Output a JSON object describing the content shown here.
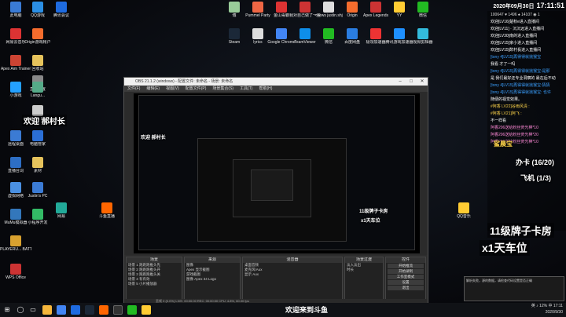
{
  "stream_clock": {
    "date": "2020年09月30日",
    "time": "17:11:51"
  },
  "desktop_icons": [
    {
      "name": "recycle-bin",
      "label": "此电脑",
      "color": "#3a7bd5"
    },
    {
      "name": "qq",
      "label": "QQ游戏",
      "color": "#2b8fe5"
    },
    {
      "name": "netease",
      "label": "腾讯会议",
      "color": "#1e6be0"
    },
    {
      "name": "netease-music",
      "label": "网易云音乐",
      "color": "#d33"
    },
    {
      "name": "origin-blue",
      "label": "Origin游戏帐户",
      "color": "#f56c2d"
    },
    {
      "name": "apex",
      "label": "Apex Aim Trainer",
      "color": "#c43"
    },
    {
      "name": "folder1",
      "label": "回收站",
      "color": "#e6c35c"
    },
    {
      "name": "recording",
      "label": "直播配置",
      "color": "#888"
    },
    {
      "name": "tencent",
      "label": "小游戏",
      "color": "#24a0ff"
    },
    {
      "name": "lang",
      "label": "Langu...",
      "color": "#5a8"
    },
    {
      "name": "which",
      "label": "Which R...",
      "color": "#ccc"
    },
    {
      "name": "rdp",
      "label": "远程桌面",
      "color": "#3b7bd4"
    },
    {
      "name": "cleaner",
      "label": "电脑管家",
      "color": "#2b6fd6"
    },
    {
      "name": "doc",
      "label": "直播台词",
      "color": "#2d6ec4"
    },
    {
      "name": "folder2",
      "label": "素材",
      "color": "#e6c35c"
    },
    {
      "name": "network",
      "label": "虚拟网络",
      "color": "#4a90e2"
    },
    {
      "name": "justin-pc",
      "label": "Justin's PC",
      "color": "#3b7bd4"
    },
    {
      "name": "wechat",
      "label": "网易",
      "color": "#2a9"
    },
    {
      "name": "douyu",
      "label": "斗鱼直播",
      "color": "#f60"
    },
    {
      "name": "mumu",
      "label": "MuMu模拟器",
      "color": "#37b"
    },
    {
      "name": "miniprog",
      "label": "小程序开发",
      "color": "#3b6"
    },
    {
      "name": "playerunknown",
      "label": "PLAYERU... BATTLEGR...",
      "color": "#d8a12f"
    },
    {
      "name": "wps",
      "label": "WPS Office",
      "color": "#c33"
    },
    {
      "name": "qqmusic",
      "label": "QQ音乐",
      "color": "#fc3"
    }
  ],
  "top_icons": [
    {
      "name": "notepad",
      "label": "傅",
      "color": "#9c9"
    },
    {
      "name": "pummel-party",
      "label": "Pummel Party",
      "color": "#e64"
    },
    {
      "name": "360",
      "label": "金山毒霸",
      "color": "#d33"
    },
    {
      "name": "chinese-app",
      "label": "我对自己做了一些",
      "color": "#c33"
    },
    {
      "name": "newsclaws",
      "label": "<news justin.shj",
      "color": "#ddd"
    },
    {
      "name": "origin",
      "label": "Origin",
      "color": "#f56c2d"
    },
    {
      "name": "apex-legends",
      "label": "Apex Legends",
      "color": "#c33"
    },
    {
      "name": "yy",
      "label": "YY",
      "color": "#fc3"
    },
    {
      "name": "wechat2",
      "label": "微信",
      "color": "#2b2"
    },
    {
      "name": "steam",
      "label": "Steam",
      "color": "#1b2838"
    },
    {
      "name": "lyrics",
      "label": "lyrics",
      "color": "#ddd"
    },
    {
      "name": "chrome",
      "label": "Google Chrome",
      "color": "#4285f4"
    },
    {
      "name": "teamviewer",
      "label": "TeamViewer",
      "color": "#0e8ee9"
    },
    {
      "name": "telegram",
      "label": "微信",
      "color": "#2b2"
    },
    {
      "name": "baidu",
      "label": "百度网盘",
      "color": "#2a7de1"
    },
    {
      "name": "gesture",
      "label": "极领加速器",
      "color": "#e33"
    },
    {
      "name": "tencent-video",
      "label": "腾讯游戏加速器",
      "color": "#1e90ff"
    },
    {
      "name": "video-edit",
      "label": "视频剪辑器",
      "color": "#3bd"
    }
  ],
  "chat": {
    "stats": "100647 ♥ 1496 ♠ 14107 ◉ 1",
    "lines": [
      {
        "text": "欢迎[LV16]楚秋e进入直播间",
        "style": "plain"
      },
      {
        "text": "欢迎[LV11] · 沉沉远进入直播间",
        "style": "plain"
      },
      {
        "text": "欢迎[LV30]南的进入直播间",
        "style": "plain"
      },
      {
        "text": "欢迎[LV15]家小进入直播间",
        "style": "plain"
      },
      {
        "text": "欢迎[LV15]酢村長进入直播间",
        "style": "plain"
      },
      {
        "text": "[tony 4]LV15]再得得就抛猴宝",
        "style": "blue"
      },
      {
        "text": "我看 才了一吗",
        "style": "plain"
      },
      {
        "text": "[tony 4]LV15]再得得就抛猴宝:是那",
        "style": "blue"
      },
      {
        "text": "是 我们最好还专业洞察的 最在后不动",
        "style": "plain"
      },
      {
        "text": "[tony 4]LV15]再得得就抛猴宝:猜猜",
        "style": "blue"
      },
      {
        "text": "[tony 4]LV15]再得得就抛猴宝: 也许",
        "style": "blue"
      },
      {
        "text": "随便的视觉效果。",
        "style": "plain"
      },
      {
        "text": "#阿香 LV22]谷雨风清 :",
        "style": "yellow"
      },
      {
        "text": "#阿香 LV21]阿飞 :",
        "style": "yellow"
      },
      {
        "text": "不一样看",
        "style": "plain"
      },
      {
        "text": "阿香206送给粉丝荧光棒*10",
        "style": "pink"
      },
      {
        "text": "阿香206送给粉丝荧光棒*20",
        "style": "pink"
      },
      {
        "text": "阿香206送给粉丝荧光棒*10",
        "style": "pink"
      }
    ]
  },
  "overlay": {
    "brand_badge": "鲨晨宝",
    "task_labels": [
      "办卡 (16/20)",
      "飞机 (1/3)"
    ],
    "banner_main": "11级牌子卡房",
    "banner_sub": "x1天车位",
    "welcome_left": "欢迎 郝村长",
    "bottom_caption": "欢迎来到斗鱼"
  },
  "obs": {
    "title": "OBS 21.1.2 (windows) - 配置文件: 未命名 - 场景: 未命名",
    "menu": [
      "文件(F)",
      "编辑(E)",
      "视图(V)",
      "配置文件(P)",
      "场景集合(S)",
      "工具(T)",
      "帮助(H)"
    ],
    "docks": {
      "scenes": {
        "title": "场景",
        "items": [
          "场景 1 跑跑跑推头先",
          "场景 2 跑跑跑推头开",
          "场景 3 跑跑跑推头关",
          "场景 4 有有效",
          "场景 5 小片播放器"
        ]
      },
      "sources": {
        "title": "来源",
        "items": [
          "图像",
          "Apex 显示截图",
          "游戏截图",
          "图像 Apex 34 Logo"
        ]
      },
      "mixer": {
        "title": "混音器",
        "items": [
          "桌面音频",
          "麦克风/Aux",
          "显示 Aux"
        ]
      },
      "transitions": {
        "title": "场景过渡",
        "items": [
          "淡入淡出",
          "时长"
        ]
      },
      "controls": {
        "title": "控件",
        "buttons": [
          "开始推流",
          "开始录制",
          "工作室模式",
          "设置",
          "退出"
        ]
      }
    },
    "status": "丢帧 0 (0.0%)   LIVE: 00:00:00   REC: 00:00:00   CPU: 4.8%, 60.00 fps"
  },
  "warn_text": "解析失败，源的数据，请检查代码设置是否正确",
  "tray": {
    "line1": "英 ♪ 12% 中 17:11",
    "line2": "2020/9/30"
  }
}
